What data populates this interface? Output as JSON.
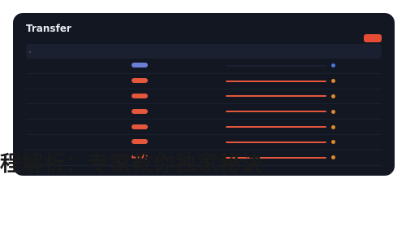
{
  "header": {
    "title": "Transfer",
    "action_label": ""
  },
  "table": {
    "columns": [
      "#",
      "",
      "",
      "",
      "",
      "",
      ""
    ],
    "rows": [
      {
        "idx": "",
        "date": "",
        "hash": "",
        "pill_color": "#6b7fd7",
        "bar_color": "#1a2030",
        "status_color": "#4a78d8",
        "status": ""
      },
      {
        "idx": "",
        "date": "",
        "hash": "",
        "pill_color": "#e4573d",
        "bar_color": "#e4573d",
        "status_color": "#e08a2c",
        "status": ""
      },
      {
        "idx": "",
        "date": "",
        "hash": "",
        "pill_color": "#e4573d",
        "bar_color": "#e4573d",
        "status_color": "#e08a2c",
        "status": ""
      },
      {
        "idx": "",
        "date": "",
        "hash": "",
        "pill_color": "#e4573d",
        "bar_color": "#e4573d",
        "status_color": "#e08a2c",
        "status": ""
      },
      {
        "idx": "",
        "date": "",
        "hash": "",
        "pill_color": "#e4573d",
        "bar_color": "#e4573d",
        "status_color": "#e08a2c",
        "status": ""
      },
      {
        "idx": "",
        "date": "",
        "hash": "",
        "pill_color": "#e4573d",
        "bar_color": "#e4573d",
        "status_color": "#e08a2c",
        "status": ""
      },
      {
        "idx": "",
        "date": "",
        "hash": "",
        "pill_color": "#e4573d",
        "bar_color": "#e4573d",
        "status_color": "#e08a2c",
        "status": ""
      }
    ]
  },
  "banner_text": "程解析：专家教你独家秘诀"
}
